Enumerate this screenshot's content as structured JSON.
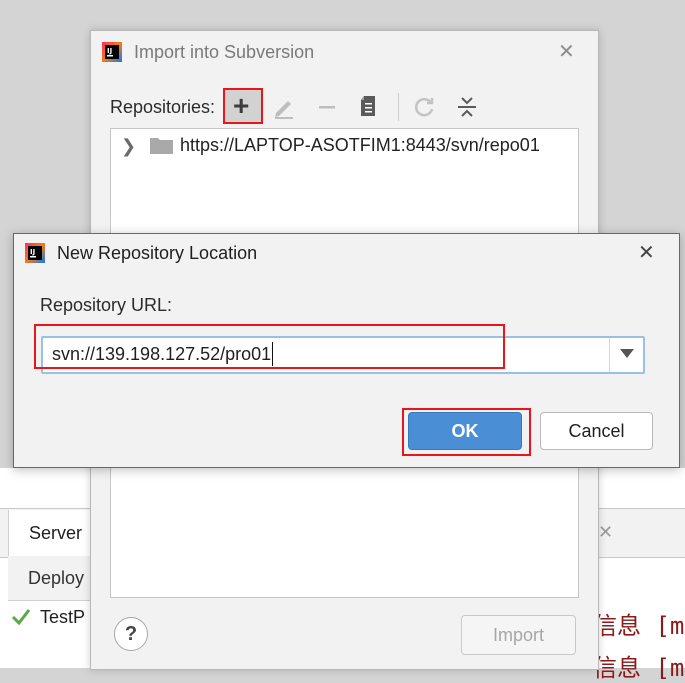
{
  "ide": {
    "tab_server": "Server",
    "row_deploy": "Deploy",
    "row_test": "TestP",
    "log_line1": "信息 [ma",
    "log_line2": "信息 [ma"
  },
  "import_dialog": {
    "title": "Import into Subversion",
    "repositories_label": "Repositories:",
    "toolbar": {
      "add": "+",
      "icons": [
        "plus-icon",
        "edit-pencil-icon",
        "minus-icon",
        "document-icon",
        "refresh-icon",
        "collapse-icon"
      ]
    },
    "tree": {
      "items": [
        {
          "url": "https://LAPTOP-ASOTFIM1:8443/svn/repo01",
          "icon": "folder-icon"
        }
      ]
    },
    "help_label": "?",
    "import_label": "Import"
  },
  "new_repo_dialog": {
    "title": "New Repository Location",
    "url_label": "Repository URL:",
    "url_value": "svn://139.198.127.52/pro01",
    "ok_label": "OK",
    "cancel_label": "Cancel"
  },
  "colors": {
    "highlight": "#e8161a",
    "primary_button": "#4a8fd6",
    "focus_border": "#9cbfe6"
  }
}
